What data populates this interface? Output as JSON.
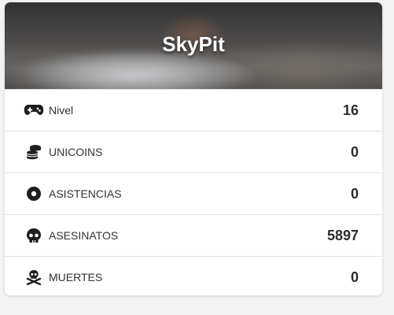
{
  "card": {
    "title": "SkyPit",
    "stats": [
      {
        "label": "Nivel",
        "value": "16",
        "icon": "gamepad-icon"
      },
      {
        "label": "UNICOINS",
        "value": "0",
        "icon": "coins-icon"
      },
      {
        "label": "ASISTENCIAS",
        "value": "0",
        "icon": "target-icon"
      },
      {
        "label": "ASESINATOS",
        "value": "5897",
        "icon": "skull-icon"
      },
      {
        "label": "MUERTES",
        "value": "0",
        "icon": "skull-crossbones-icon"
      }
    ]
  },
  "colors": {
    "icon": "#1f1f1f",
    "text": "#333333",
    "value": "#2b2b2b",
    "divider": "#e3e3e3"
  }
}
